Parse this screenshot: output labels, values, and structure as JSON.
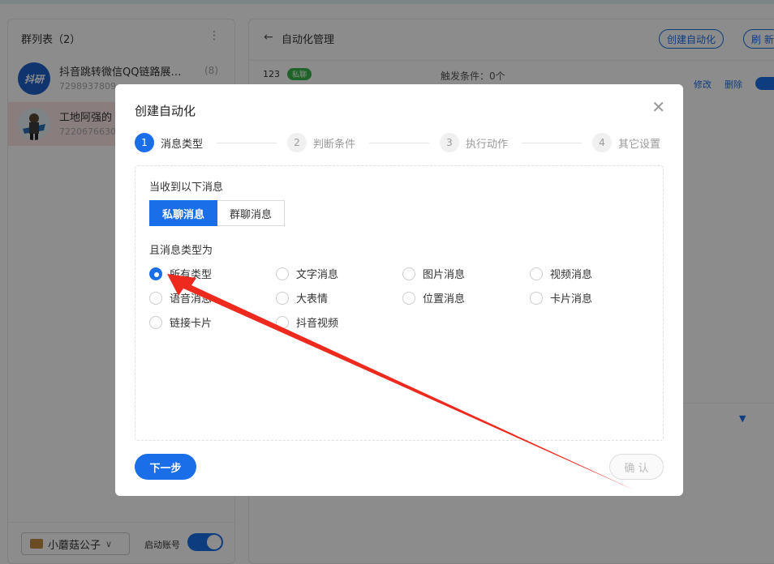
{
  "left_panel": {
    "title": "群列表（2）",
    "more_icon": "vertical-ellipsis-icon",
    "groups": [
      {
        "name": "抖音跳转微信QQ链路展…",
        "id": "7298937809",
        "count": "(8)",
        "avatar_text": "抖研",
        "avatar_color": "#1d5fc8"
      },
      {
        "name": "工地阿强的",
        "id": "7220676630",
        "count": "",
        "avatar_text": "",
        "avatar_color": "#dbe5ee"
      }
    ],
    "account_name": "小蘑菇公子",
    "enable_label": "启动账号",
    "enable_on": true
  },
  "right_panel": {
    "title": "自动化管理",
    "create_button": "创建自动化",
    "refresh_button": "刷 新",
    "rule": {
      "name": "123",
      "tag": "私聊",
      "condition": "触发条件：0个",
      "edit": "修改",
      "delete": "删除"
    }
  },
  "modal": {
    "title": "创建自动化",
    "steps": [
      {
        "num": "1",
        "label": "消息类型",
        "active": true
      },
      {
        "num": "2",
        "label": "判断条件",
        "active": false
      },
      {
        "num": "3",
        "label": "执行动作",
        "active": false
      },
      {
        "num": "4",
        "label": "其它设置",
        "active": false
      }
    ],
    "when_label": "当收到以下消息",
    "source_options": [
      {
        "label": "私聊消息",
        "selected": true
      },
      {
        "label": "群聊消息",
        "selected": false
      }
    ],
    "type_label": "且消息类型为",
    "type_options": [
      {
        "label": "所有类型",
        "selected": true
      },
      {
        "label": "文字消息",
        "selected": false
      },
      {
        "label": "图片消息",
        "selected": false
      },
      {
        "label": "视频消息",
        "selected": false
      },
      {
        "label": "语音消息",
        "selected": false
      },
      {
        "label": "大表情",
        "selected": false
      },
      {
        "label": "位置消息",
        "selected": false
      },
      {
        "label": "卡片消息",
        "selected": false
      },
      {
        "label": "链接卡片",
        "selected": false
      },
      {
        "label": "抖音视频",
        "selected": false
      }
    ],
    "next_button": "下一步",
    "confirm_button": "确 认"
  },
  "annotation": {
    "color": "#ee2a1e",
    "icon": "red-arrow-icon"
  }
}
